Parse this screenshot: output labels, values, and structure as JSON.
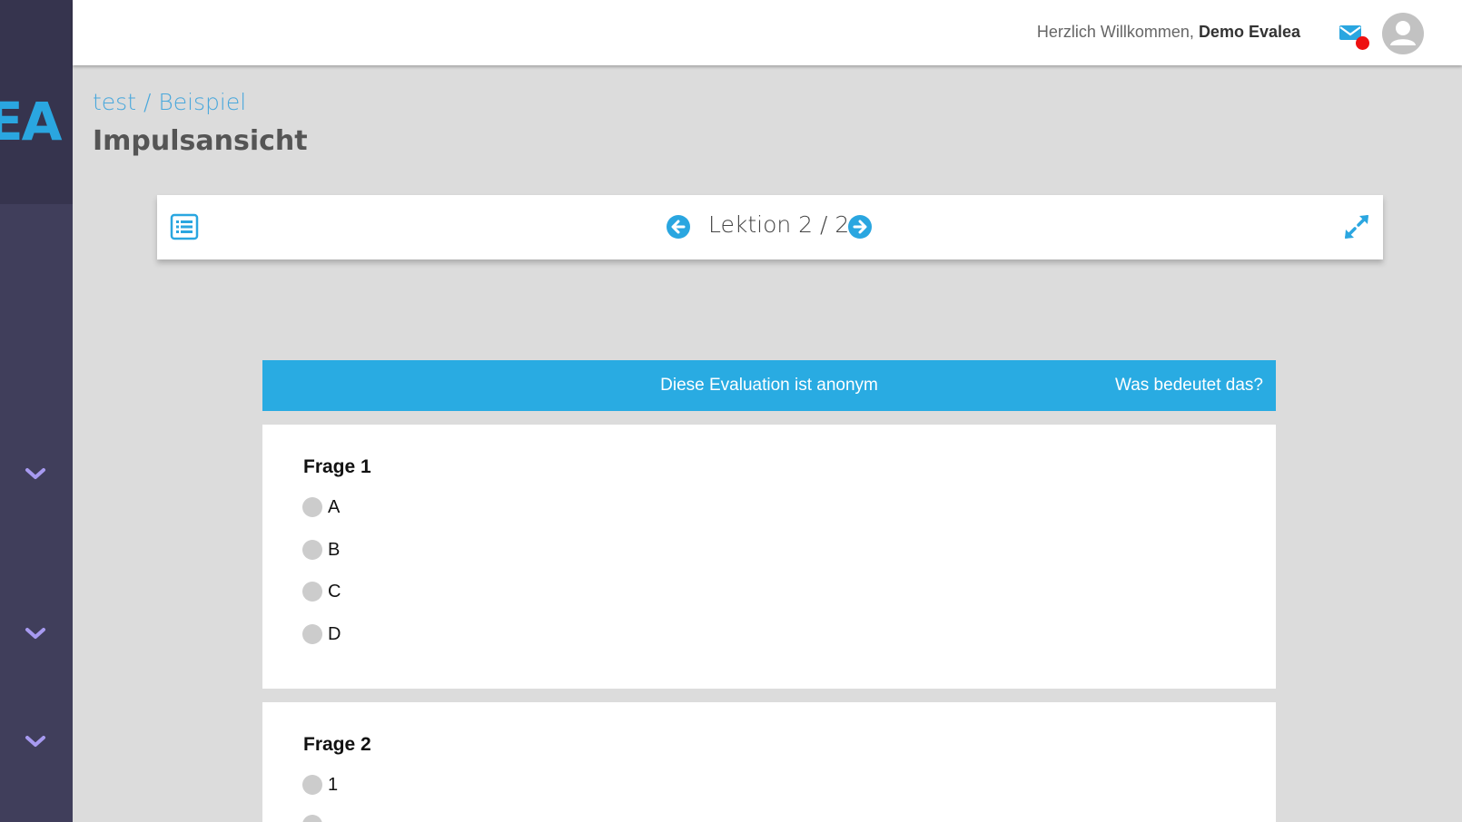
{
  "sidebar": {
    "logo_text": "EA",
    "accent": "#2aa6e0"
  },
  "topbar": {
    "welcome_prefix": "Herzlich Willkommen,",
    "user_name": "Demo Evalea",
    "notification_dot_color": "#ee1111"
  },
  "page": {
    "breadcrumb": "test / Beispiel",
    "title": "Impulsansicht"
  },
  "lesson_nav": {
    "label": "Lektion 2 / 2",
    "current": 2,
    "total": 2
  },
  "banner": {
    "text": "Diese Evaluation ist anonym",
    "link": "Was bedeutet das?",
    "color": "#29abe2"
  },
  "questions": [
    {
      "title": "Frage 1",
      "options": [
        "A",
        "B",
        "C",
        "D"
      ]
    },
    {
      "title": "Frage 2",
      "options": [
        "1"
      ]
    }
  ]
}
